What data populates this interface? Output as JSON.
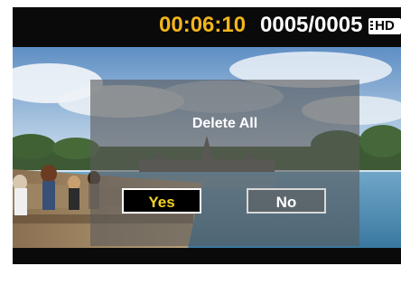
{
  "status": {
    "timecode": "00:06:10",
    "file_counter": "0005/0005",
    "quality_badge": "HD"
  },
  "dialog": {
    "title": "Delete All",
    "yes_label": "Yes",
    "no_label": "No",
    "selected": "Yes"
  },
  "background": {
    "icon": "photo-preview-temple-scene"
  },
  "colors": {
    "timecode": "#f2b51e",
    "selected_label": "#f5d21e",
    "dialog_overlay": "#5a5a5a"
  }
}
